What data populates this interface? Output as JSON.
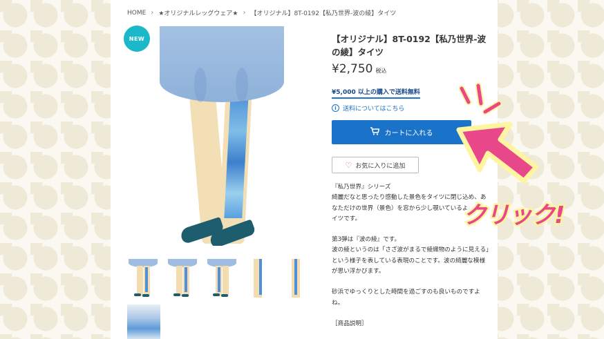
{
  "breadcrumb": {
    "home": "HOME",
    "category": "★オリジナルレッグウェア★",
    "current": "【オリジナル】8T-0192【私乃世界-波の綾】タイツ"
  },
  "badge": "NEW",
  "product": {
    "title": "【オリジナル】8T-0192【私乃世界-波の綾】タイツ",
    "price": "¥2,750",
    "tax_label": "税込",
    "free_shipping": "¥5,000 以上の購入で送料無料",
    "shipping_info": "送料についてはこちら",
    "cart_button": "カートに入れる",
    "favorite_button": "お気に入りに追加"
  },
  "description": [
    "『私乃世界』シリーズ\n綺麗だなと思ったり感動した景色をタイツに閉じ込め、あなただけの世界（景色）を窓から少し覗いているよ\nイツです。",
    "第3弾は『波の綾』です。\n波の綾というのは「さざ波がまるで綾織物のように見える」という様子を表している表現のことです。波の綺麗な模様が思い浮かびます。",
    "砂浜でゆっくりとした時間を過ごすのも良いものですよね。",
    "［商品説明］"
  ],
  "overlay": {
    "click_text": "クリック!"
  },
  "colors": {
    "accent_blue": "#1a73c9",
    "badge_teal": "#1ab8c9",
    "overlay_pink": "#e8488a",
    "overlay_yellow": "#fff5a0"
  }
}
